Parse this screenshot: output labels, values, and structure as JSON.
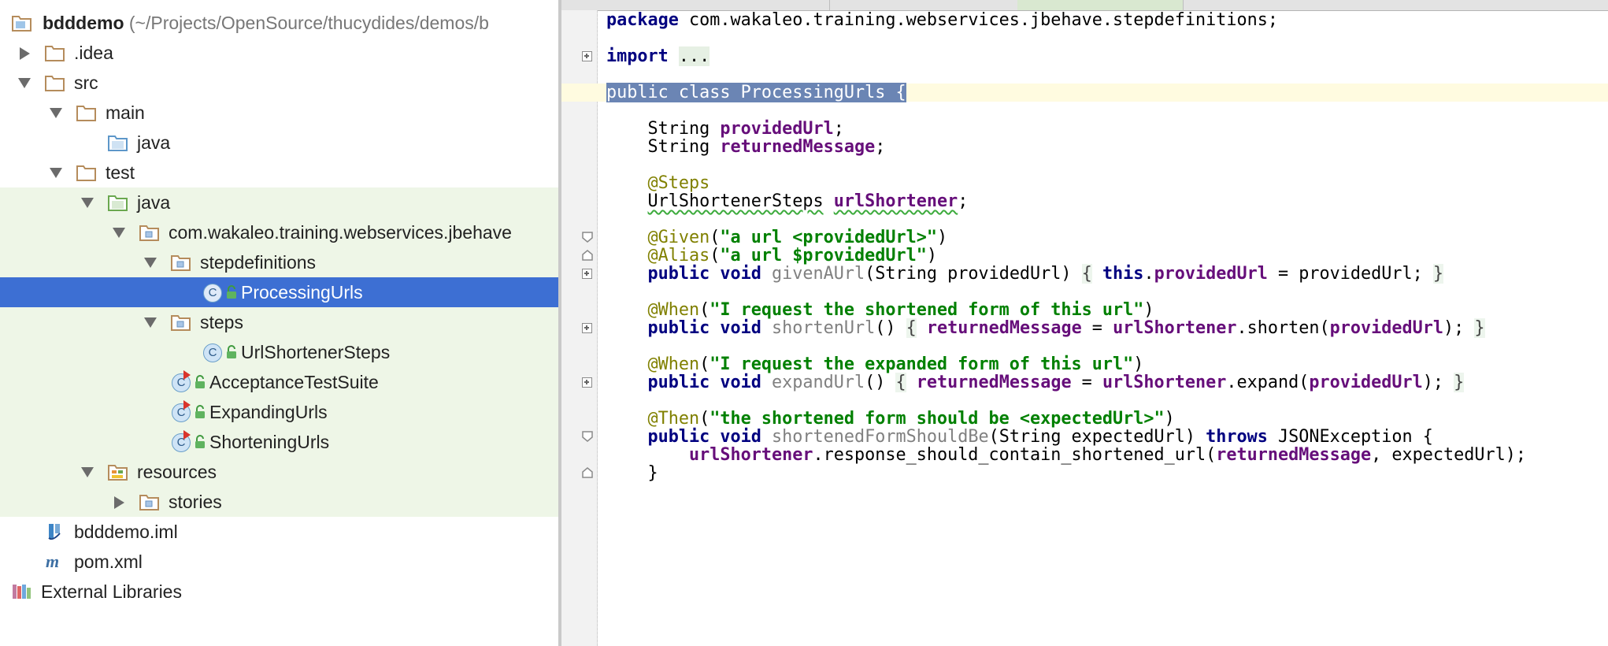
{
  "project_tree": {
    "items": [
      {
        "label": "bdddemo",
        "path": "(~/Projects/OpenSource/thucydides/demos/b",
        "bold": true,
        "icon": "module-icon",
        "arrow": "none"
      },
      {
        "label": ".idea",
        "icon": "folder-icon",
        "arrow": "right"
      },
      {
        "label": "src",
        "icon": "folder-icon",
        "arrow": "down"
      },
      {
        "label": "main",
        "icon": "folder-icon",
        "arrow": "down"
      },
      {
        "label": "java",
        "icon": "source-folder-icon",
        "arrow": "none"
      },
      {
        "label": "test",
        "icon": "folder-icon",
        "arrow": "down"
      },
      {
        "label": "java",
        "icon": "test-source-folder-icon",
        "arrow": "down"
      },
      {
        "label": "com.wakaleo.training.webservices.jbehave",
        "icon": "package-icon",
        "arrow": "down"
      },
      {
        "label": "stepdefinitions",
        "icon": "package-icon",
        "arrow": "down"
      },
      {
        "label": "ProcessingUrls",
        "icon": "class-icon",
        "arrow": "none",
        "selected": true
      },
      {
        "label": "steps",
        "icon": "package-icon",
        "arrow": "down"
      },
      {
        "label": "UrlShortenerSteps",
        "icon": "class-icon",
        "arrow": "none"
      },
      {
        "label": "AcceptanceTestSuite",
        "icon": "test-class-icon",
        "arrow": "none"
      },
      {
        "label": "ExpandingUrls",
        "icon": "test-class-icon",
        "arrow": "none"
      },
      {
        "label": "ShorteningUrls",
        "icon": "test-class-icon",
        "arrow": "none"
      },
      {
        "label": "resources",
        "icon": "resources-folder-icon",
        "arrow": "down"
      },
      {
        "label": "stories",
        "icon": "package-icon",
        "arrow": "right"
      },
      {
        "label": "bdddemo.iml",
        "icon": "iml-file-icon",
        "arrow": "none"
      },
      {
        "label": "pom.xml",
        "icon": "maven-file-icon",
        "arrow": "none"
      },
      {
        "label": "External Libraries",
        "icon": "libraries-icon",
        "arrow": "none"
      }
    ],
    "class_icon_letter": "C"
  },
  "editor": {
    "lines": [
      {
        "tokens": [
          [
            "kw",
            "package"
          ],
          [
            "t",
            " com.wakaleo.training.webservices.jbehave.stepdefinitions;"
          ]
        ]
      },
      {
        "tokens": []
      },
      {
        "tokens": [
          [
            "kw",
            "import"
          ],
          [
            "t",
            " "
          ],
          [
            "fold",
            "..."
          ]
        ]
      },
      {
        "tokens": []
      },
      {
        "tokens": [
          [
            "sel",
            "public class ProcessingUrls {"
          ]
        ]
      },
      {
        "tokens": []
      },
      {
        "tokens": [
          [
            "t",
            "    String "
          ],
          [
            "field",
            "providedUrl"
          ],
          [
            "t",
            ";"
          ]
        ]
      },
      {
        "tokens": [
          [
            "t",
            "    String "
          ],
          [
            "field",
            "returnedMessage"
          ],
          [
            "t",
            ";"
          ]
        ]
      },
      {
        "tokens": []
      },
      {
        "tokens": [
          [
            "ann",
            "    @Steps"
          ]
        ]
      },
      {
        "tokens": [
          [
            "t",
            "    UrlShortenerSteps "
          ],
          [
            "field",
            "urlShortener"
          ],
          [
            "t",
            ";"
          ]
        ]
      },
      {
        "tokens": []
      },
      {
        "tokens": [
          [
            "ann",
            "    @Given"
          ],
          [
            "t",
            "("
          ],
          [
            "str",
            "\"a url <providedUrl>\""
          ],
          [
            "t",
            ")"
          ]
        ]
      },
      {
        "tokens": [
          [
            "ann",
            "    @Alias"
          ],
          [
            "t",
            "("
          ],
          [
            "str",
            "\"a url $providedUrl\""
          ],
          [
            "t",
            ")"
          ]
        ]
      },
      {
        "tokens": [
          [
            "t",
            "    "
          ],
          [
            "kw",
            "public void "
          ],
          [
            "unused",
            "givenAUrl"
          ],
          [
            "t",
            "(String providedUrl) "
          ],
          [
            "brace",
            "{"
          ],
          [
            "t",
            " "
          ],
          [
            "kw",
            "this"
          ],
          [
            "t",
            "."
          ],
          [
            "field",
            "providedUrl"
          ],
          [
            "t",
            " = providedUrl; "
          ],
          [
            "brace",
            "}"
          ]
        ]
      },
      {
        "tokens": []
      },
      {
        "tokens": [
          [
            "ann",
            "    @When"
          ],
          [
            "t",
            "("
          ],
          [
            "str",
            "\"I request the shortened form of this url\""
          ],
          [
            "t",
            ")"
          ]
        ]
      },
      {
        "tokens": [
          [
            "t",
            "    "
          ],
          [
            "kw",
            "public void "
          ],
          [
            "unused",
            "shortenUrl"
          ],
          [
            "t",
            "() "
          ],
          [
            "brace",
            "{"
          ],
          [
            "t",
            " "
          ],
          [
            "field",
            "returnedMessage"
          ],
          [
            "t",
            " = "
          ],
          [
            "field",
            "urlShortener"
          ],
          [
            "t",
            ".shorten("
          ],
          [
            "field",
            "providedUrl"
          ],
          [
            "t",
            "); "
          ],
          [
            "brace",
            "}"
          ]
        ]
      },
      {
        "tokens": []
      },
      {
        "tokens": [
          [
            "ann",
            "    @When"
          ],
          [
            "t",
            "("
          ],
          [
            "str",
            "\"I request the expanded form of this url\""
          ],
          [
            "t",
            ")"
          ]
        ]
      },
      {
        "tokens": [
          [
            "t",
            "    "
          ],
          [
            "kw",
            "public void "
          ],
          [
            "unused",
            "expandUrl"
          ],
          [
            "t",
            "() "
          ],
          [
            "brace",
            "{"
          ],
          [
            "t",
            " "
          ],
          [
            "field",
            "returnedMessage"
          ],
          [
            "t",
            " = "
          ],
          [
            "field",
            "urlShortener"
          ],
          [
            "t",
            ".expand("
          ],
          [
            "field",
            "providedUrl"
          ],
          [
            "t",
            "); "
          ],
          [
            "brace",
            "}"
          ]
        ]
      },
      {
        "tokens": []
      },
      {
        "tokens": [
          [
            "ann",
            "    @Then"
          ],
          [
            "t",
            "("
          ],
          [
            "str",
            "\"the shortened form should be <expectedUrl>\""
          ],
          [
            "t",
            ")"
          ]
        ]
      },
      {
        "tokens": [
          [
            "t",
            "    "
          ],
          [
            "kw",
            "public void "
          ],
          [
            "unused",
            "shortenedFormShouldBe"
          ],
          [
            "t",
            "(String expectedUrl) "
          ],
          [
            "kw",
            "throws"
          ],
          [
            "t",
            " JSONException {"
          ]
        ]
      },
      {
        "tokens": [
          [
            "t",
            "        "
          ],
          [
            "field",
            "urlShortener"
          ],
          [
            "t",
            ".response_should_contain_shortened_url("
          ],
          [
            "field",
            "returnedMessage"
          ],
          [
            "t",
            ", expectedUrl);"
          ]
        ]
      },
      {
        "tokens": [
          [
            "t",
            "    }"
          ]
        ]
      }
    ]
  },
  "colors": {
    "selection": "#3d6fd3",
    "keyword": "#000080",
    "annotation": "#808000",
    "string": "#008000",
    "field": "#660e7a",
    "test_area": "#eef6e7",
    "caret_line": "#fffbe0"
  }
}
